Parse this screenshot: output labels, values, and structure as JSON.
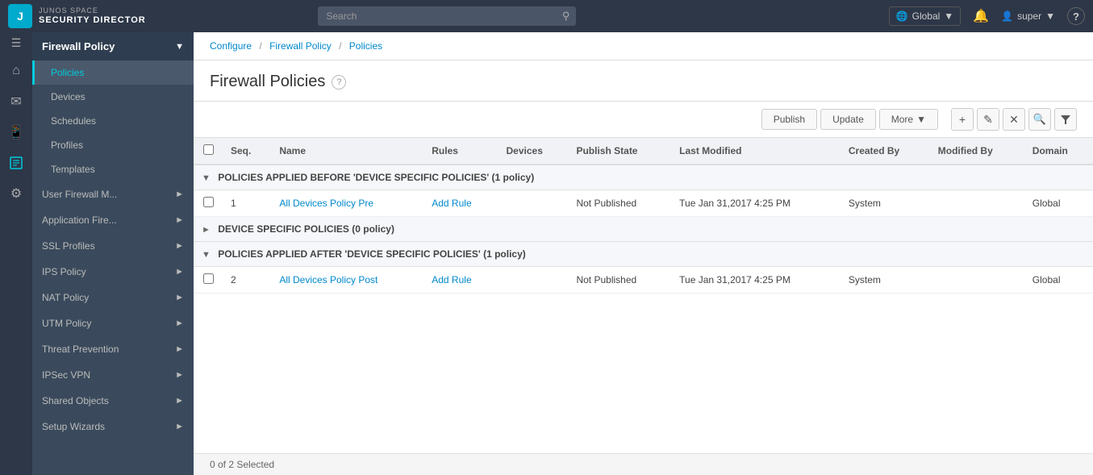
{
  "app": {
    "logo_top": "JUNOS SPACE",
    "logo_bottom": "SECURITY DIRECTOR",
    "logo_letter": "J"
  },
  "topbar": {
    "search_placeholder": "Search",
    "global_label": "Global",
    "user_label": "super",
    "help_label": "?"
  },
  "breadcrumb": {
    "configure": "Configure",
    "firewall_policy": "Firewall Policy",
    "policies": "Policies"
  },
  "page": {
    "title": "Firewall Policies"
  },
  "toolbar": {
    "publish": "Publish",
    "update": "Update",
    "more": "More"
  },
  "table": {
    "columns": [
      "Seq.",
      "Name",
      "Rules",
      "Devices",
      "Publish State",
      "Last Modified",
      "Created By",
      "Modified By",
      "Domain"
    ],
    "groups": [
      {
        "id": "group1",
        "label": "POLICIES APPLIED BEFORE 'DEVICE SPECIFIC POLICIES' (1 policy)",
        "collapsed": false,
        "rows": [
          {
            "seq": "1",
            "name": "All Devices Policy Pre",
            "rules": "Add Rule",
            "devices": "",
            "publish_state": "Not Published",
            "last_modified": "Tue Jan 31,2017 4:25 PM",
            "created_by": "System",
            "modified_by": "",
            "domain": "Global"
          }
        ]
      },
      {
        "id": "group2",
        "label": "DEVICE SPECIFIC POLICIES (0 policy)",
        "collapsed": true,
        "rows": []
      },
      {
        "id": "group3",
        "label": "POLICIES APPLIED AFTER 'DEVICE SPECIFIC POLICIES' (1 policy)",
        "collapsed": false,
        "rows": [
          {
            "seq": "2",
            "name": "All Devices Policy Post",
            "rules": "Add Rule",
            "devices": "",
            "publish_state": "Not Published",
            "last_modified": "Tue Jan 31,2017 4:25 PM",
            "created_by": "System",
            "modified_by": "",
            "domain": "Global"
          }
        ]
      }
    ]
  },
  "status": {
    "selected": "0 of 2 Selected"
  },
  "sidebar": {
    "firewall_policy_header": "Firewall Policy",
    "nav_items": [
      {
        "id": "policies",
        "label": "Policies",
        "active": true
      },
      {
        "id": "devices",
        "label": "Devices",
        "active": false
      },
      {
        "id": "schedules",
        "label": "Schedules",
        "active": false
      },
      {
        "id": "profiles",
        "label": "Profiles",
        "active": false
      },
      {
        "id": "templates",
        "label": "Templates",
        "active": false
      }
    ],
    "groups": [
      {
        "id": "user-firewall",
        "label": "User Firewall M...",
        "has_arrow": true
      },
      {
        "id": "application-fire",
        "label": "Application Fire...",
        "has_arrow": true
      },
      {
        "id": "ssl-profiles",
        "label": "SSL Profiles",
        "has_arrow": true
      },
      {
        "id": "ips-policy",
        "label": "IPS Policy",
        "has_arrow": true
      },
      {
        "id": "nat-policy",
        "label": "NAT Policy",
        "has_arrow": true
      },
      {
        "id": "utm-policy",
        "label": "UTM Policy",
        "has_arrow": true
      },
      {
        "id": "threat-prevention",
        "label": "Threat Prevention",
        "has_arrow": true
      },
      {
        "id": "ipsec-vpn",
        "label": "IPSec VPN",
        "has_arrow": true
      },
      {
        "id": "shared-objects",
        "label": "Shared Objects",
        "has_arrow": true
      },
      {
        "id": "setup-wizards",
        "label": "Setup Wizards",
        "has_arrow": true
      }
    ]
  }
}
